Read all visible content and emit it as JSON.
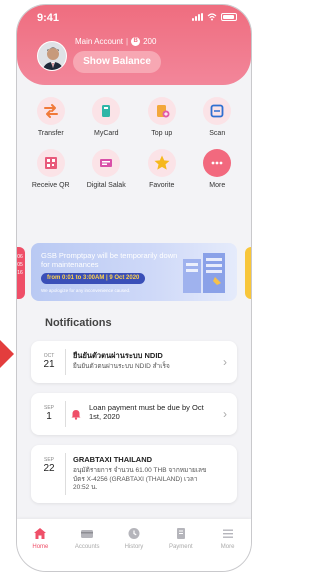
{
  "status": {
    "time": "9:41"
  },
  "header": {
    "account_label": "Main Account",
    "separator": "|",
    "coin_symbol": "B",
    "coin_value": "200",
    "show_balance_label": "Show Balance"
  },
  "menu": {
    "row1": [
      {
        "label": "Transfer",
        "icon": "transfer-icon"
      },
      {
        "label": "MyCard",
        "icon": "card-icon"
      },
      {
        "label": "Top up",
        "icon": "topup-icon"
      },
      {
        "label": "Scan",
        "icon": "scan-icon"
      }
    ],
    "row2": [
      {
        "label": "Receive QR",
        "icon": "qr-icon"
      },
      {
        "label": "Digital Salak",
        "icon": "salak-icon"
      },
      {
        "label": "Favorite",
        "icon": "star-icon"
      },
      {
        "label": "More",
        "icon": "more-icon"
      }
    ]
  },
  "banner": {
    "title": "GSB Promptpay will be temporarily down for maintenances",
    "time": "from 0:01 to 3:00AM | 9 Oct 2020",
    "subtitle": "We apologize for any inconvenience caused.",
    "left_tab": "06 05 16"
  },
  "notifications": {
    "title": "Notifications",
    "items": [
      {
        "month": "OCT",
        "day": "21",
        "head": "ยืนยันตัวตนผ่านระบบ NDID",
        "body": "ยืนยันตัวตนผ่านระบบ NDID สำเร็จ"
      },
      {
        "month": "SEP",
        "day": "1",
        "head": "Loan payment must be due by Oct 1st, 2020",
        "body": ""
      },
      {
        "month": "SEP",
        "day": "22",
        "head": "GRABTAXI THAILAND",
        "body": "อนุมัติรายการ จำนวน 61.00 THB จากหมายเลขบัตร X-4256 (GRABTAXI (THAILAND) เวลา 20:52 น."
      }
    ]
  },
  "bottom_nav": [
    {
      "label": "Home",
      "active": true
    },
    {
      "label": "Accounts",
      "active": false
    },
    {
      "label": "History",
      "active": false
    },
    {
      "label": "Payment",
      "active": false
    },
    {
      "label": "More",
      "active": false
    }
  ],
  "colors": {
    "brand_pink": "#ef6d7f",
    "accent_red": "#ef4f68",
    "banner_blue": "#3a4fb8",
    "banner_yellow": "#ffd34d"
  }
}
